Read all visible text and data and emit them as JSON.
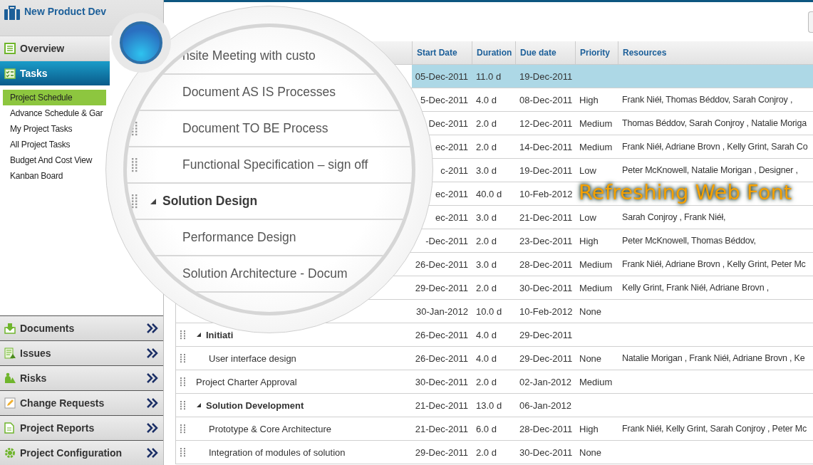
{
  "sidebar": {
    "title": "New Product Dev",
    "sections": [
      {
        "label": "Overview",
        "selected": false
      },
      {
        "label": "Tasks",
        "selected": true,
        "items": [
          {
            "label": "Project Schedule",
            "selected": true
          },
          {
            "label": "Advance Schedule & Gar",
            "selected": false
          },
          {
            "label": "My Project Tasks",
            "selected": false
          },
          {
            "label": "All Project Tasks",
            "selected": false
          },
          {
            "label": "Budget And Cost View",
            "selected": false
          },
          {
            "label": "Kanban Board",
            "selected": false
          }
        ]
      }
    ],
    "collapsed_sections": [
      {
        "label": "Documents"
      },
      {
        "label": "Issues"
      },
      {
        "label": "Risks"
      },
      {
        "label": "Change Requests"
      },
      {
        "label": "Project Reports"
      },
      {
        "label": "Project Configuration"
      }
    ]
  },
  "table": {
    "columns": [
      "Start Date",
      "Duration",
      "Due date",
      "Priority",
      "Resources"
    ],
    "rows": [
      {
        "selected": true,
        "start": "05-Dec-2011",
        "duration": "11.0 d",
        "due": "19-Dec-2011"
      },
      {
        "selected": false,
        "start": "5-Dec-2011",
        "duration": "4.0 d",
        "due": "08-Dec-2011",
        "priority": "High",
        "resources": "Frank Niéł, Thomas Béddov, Sarah Conjroy ,"
      },
      {
        "selected": false,
        "start": "Dec-2011",
        "duration": "2.0 d",
        "due": "12-Dec-2011",
        "priority": "Medium",
        "resources": "Thomas Béddov, Sarah Conjroy , Natalie Moriga"
      },
      {
        "selected": false,
        "start": "ec-2011",
        "duration": "2.0 d",
        "due": "14-Dec-2011",
        "priority": "Medium",
        "resources": "Frank Niéł, Adriane Brovn , Kelly Grint, Sarah Co"
      },
      {
        "selected": false,
        "start": "c-2011",
        "duration": "3.0 d",
        "due": "19-Dec-2011",
        "priority": "Low",
        "resources": "Peter McKnowell, Natalie Morigan , Designer ,"
      },
      {
        "selected": false,
        "start": "ec-2011",
        "duration": "40.0 d",
        "due": "10-Feb-2012"
      },
      {
        "selected": false,
        "start": "ec-2011",
        "duration": "3.0 d",
        "due": "21-Dec-2011",
        "priority": "Low",
        "resources": "Sarah Conjroy , Frank Niéł,"
      },
      {
        "selected": false,
        "start": "-Dec-2011",
        "duration": "2.0 d",
        "due": "23-Dec-2011",
        "priority": "High",
        "resources": "Peter McKnowell, Thomas Béddov,"
      },
      {
        "selected": false,
        "start": "26-Dec-2011",
        "duration": "3.0 d",
        "due": "28-Dec-2011",
        "priority": "Medium",
        "resources": "Frank Niéł, Adriane Brovn , Kelly Grint, Peter Mc"
      },
      {
        "selected": false,
        "start": "29-Dec-2011",
        "duration": "2.0 d",
        "due": "30-Dec-2011",
        "priority": "Medium",
        "resources": "Kelly Grint, Frank Niéł, Adriane Brovn ,"
      },
      {
        "selected": false,
        "start": "30-Jan-2012",
        "duration": "10.0 d",
        "due": "10-Feb-2012",
        "priority": "None"
      },
      {
        "kind": "group",
        "name": "Initiati",
        "expanded": true,
        "selected": false,
        "start": "26-Dec-2011",
        "duration": "4.0 d",
        "due": "29-Dec-2011",
        "children": [
          {
            "kind": "task",
            "name": "User interface design",
            "selected": false,
            "start": "26-Dec-2011",
            "duration": "4.0 d",
            "due": "29-Dec-2011",
            "priority": "None",
            "resources": "Natalie Morigan , Frank Niéł, Adriane Brovn , Ke"
          }
        ]
      },
      {
        "kind": "task",
        "name": "Project Charter Approval",
        "selected": false,
        "start": "30-Dec-2011",
        "duration": "2.0 d",
        "due": "02-Jan-2012",
        "priority": "Medium"
      },
      {
        "kind": "group",
        "name": "Solution Development",
        "expanded": true,
        "selected": false,
        "start": "21-Dec-2011",
        "duration": "13.0 d",
        "due": "06-Jan-2012",
        "children": [
          {
            "kind": "task",
            "name": "Prototype & Core Architecture",
            "selected": false,
            "start": "21-Dec-2011",
            "duration": "6.0 d",
            "due": "28-Dec-2011",
            "priority": "High",
            "resources": "Frank Niéł, Kelly Grint, Sarah Conjroy , Peter Mc"
          },
          {
            "kind": "task",
            "name": "Integration of modules of solution",
            "selected": false,
            "start": "29-Dec-2011",
            "duration": "2.0 d",
            "due": "30-Dec-2011",
            "priority": "None"
          }
        ]
      }
    ]
  },
  "magnifier": {
    "rows": [
      {
        "kind": "task",
        "text": "nsite Meeting with custo"
      },
      {
        "kind": "task",
        "text": "Document AS IS Processes"
      },
      {
        "kind": "task",
        "text": "Document TO BE Process"
      },
      {
        "kind": "task",
        "text": "Functional Specification – sign off"
      },
      {
        "kind": "group",
        "text": "Solution Design",
        "expanded": true
      },
      {
        "kind": "task",
        "text": "Performance Design"
      },
      {
        "kind": "task",
        "text": "Solution Architecture - Docum"
      }
    ]
  },
  "caption": "Refreshing Web Font"
}
